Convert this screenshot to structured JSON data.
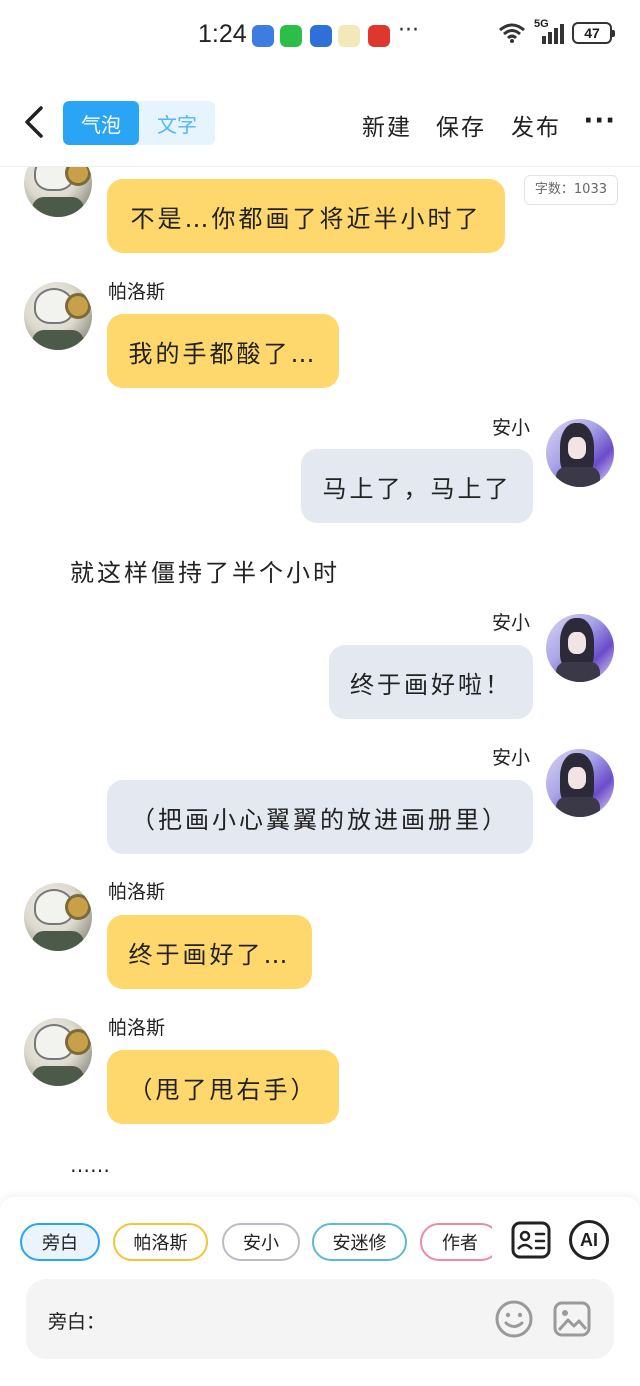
{
  "status_bar": {
    "time": "1:24",
    "dots": "···",
    "network": "5G",
    "battery": "47"
  },
  "header": {
    "tabs": [
      "气泡",
      "文字"
    ],
    "actions": [
      "新建",
      "保存",
      "发布"
    ],
    "more": "···"
  },
  "chat": {
    "word_count": "字数：1033",
    "messages": [
      {
        "side": "left",
        "speaker": "",
        "text": "不是…你都画了将近半小时了"
      },
      {
        "side": "left",
        "speaker": "帕洛斯",
        "text": "我的手都酸了…"
      },
      {
        "side": "right",
        "speaker": "安小",
        "text": "马上了，马上了"
      },
      {
        "side": "narration",
        "text": "就这样僵持了半个小时"
      },
      {
        "side": "right",
        "speaker": "安小",
        "text": "终于画好啦！"
      },
      {
        "side": "right",
        "speaker": "安小",
        "text": "（把画小心翼翼的放进画册里）"
      },
      {
        "side": "left",
        "speaker": "帕洛斯",
        "text": "终于画好了…"
      },
      {
        "side": "left",
        "speaker": "帕洛斯",
        "text": "（甩了甩右手）"
      },
      {
        "side": "narration",
        "text": "……"
      }
    ]
  },
  "composer": {
    "roles": [
      {
        "label": "旁白",
        "color": "#2aa4f4",
        "selected": true
      },
      {
        "label": "帕洛斯",
        "color": "#f2c43a",
        "selected": false
      },
      {
        "label": "安小",
        "color": "#b9bcc6",
        "selected": false
      },
      {
        "label": "安迷修",
        "color": "#5fb8d6",
        "selected": false
      },
      {
        "label": "作者",
        "color": "#f08aa0",
        "selected": false
      }
    ],
    "ai_label": "AI",
    "input_label": "旁白：",
    "input_placeholder": ""
  },
  "colors": {
    "accent": "#2aa4f4",
    "bubble_left": "#fed86c",
    "bubble_right": "#e3e8f1"
  }
}
